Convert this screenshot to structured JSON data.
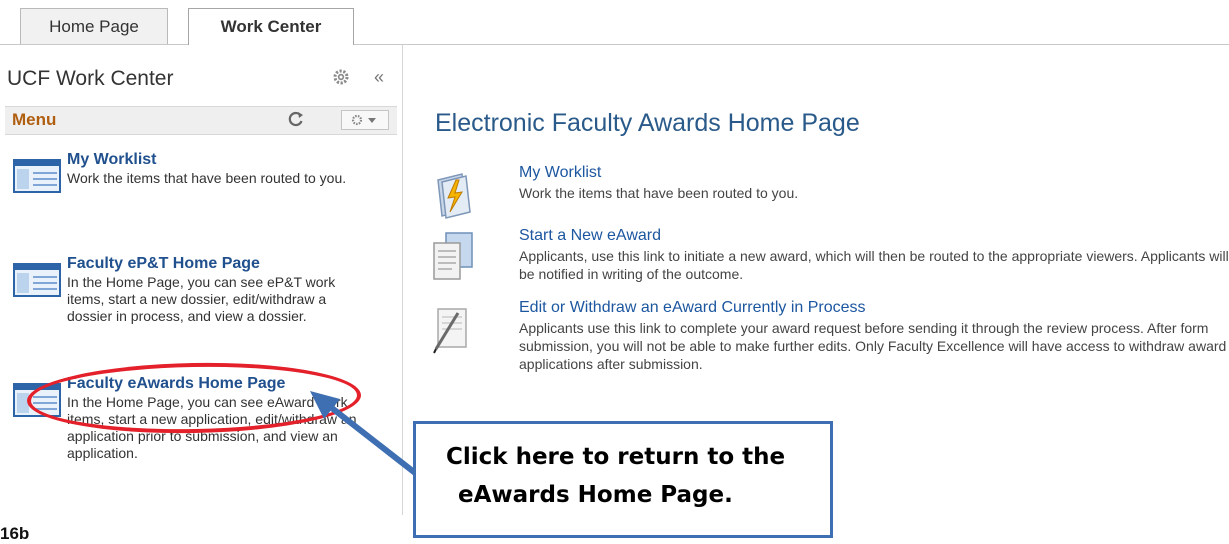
{
  "tabs": [
    {
      "label": "Home Page",
      "active": false
    },
    {
      "label": "Work Center",
      "active": true
    }
  ],
  "left_panel": {
    "title": "UCF Work Center",
    "menu_label": "Menu",
    "items": [
      {
        "title": "My Worklist",
        "description": "Work the items that have been routed to you."
      },
      {
        "title": "Faculty eP&T Home Page",
        "description": "In the Home Page, you can see eP&T work items, start a new dossier, edit/withdraw a dossier in process, and view a dossier."
      },
      {
        "title": "Faculty eAwards Home Page",
        "description": "In the Home Page, you can see eAward work items, start a new application, edit/withdraw an application prior to submission, and view an application."
      }
    ]
  },
  "content": {
    "title": "Electronic Faculty Awards Home Page",
    "links": [
      {
        "title": "My Worklist",
        "description": "Work the items that have been routed to you.",
        "icon": "lightning-folder-icon"
      },
      {
        "title": "Start a New eAward",
        "description": "Applicants, use this link to initiate a new award, which will then be routed to the appropriate viewers. Applicants will be notified in writing of the outcome.",
        "icon": "documents-icon"
      },
      {
        "title": "Edit or Withdraw an eAward Currently in Process",
        "description": "Applicants use this link to complete your award request before sending it through the review process.  After form submission, you will not be able to make further edits. Only Faculty Excellence will have access to withdraw award applications after submission.",
        "icon": "pen-paper-icon"
      }
    ]
  },
  "annotation": {
    "callout_line1": "Click here to return to the",
    "callout_line2": "eAwards Home Page.",
    "highlight_color": "#e4202a",
    "callout_border_color": "#3e6fb3"
  },
  "figure_label": "16b"
}
